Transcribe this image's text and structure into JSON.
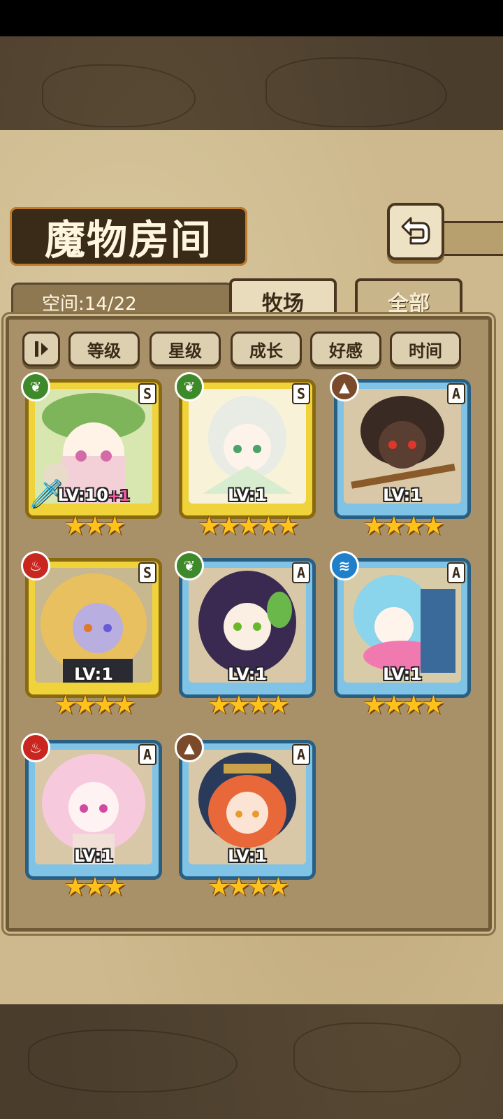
{
  "header": {
    "title": "魔物房间",
    "back_icon": "back-arrow-icon"
  },
  "storage": {
    "space_label": "空间:14/22"
  },
  "tabs": [
    {
      "label": "牧场",
      "active": true
    },
    {
      "label": "全部",
      "active": false
    }
  ],
  "filters": {
    "toggle_icon": "sort-toggle-icon",
    "items": [
      "等级",
      "星级",
      "成长",
      "好感",
      "时间"
    ]
  },
  "monsters": [
    {
      "element": "leaf",
      "rank": "S",
      "level": "LV:10",
      "bonus": "+1",
      "stars": "★★★",
      "frame": "gold",
      "equipped": "sword-icon"
    },
    {
      "element": "leaf",
      "rank": "S",
      "level": "LV:1",
      "bonus": "",
      "stars": "★★★★★",
      "frame": "gold",
      "equipped": ""
    },
    {
      "element": "earth",
      "rank": "A",
      "level": "LV:1",
      "bonus": "",
      "stars": "★★★★",
      "frame": "blue",
      "equipped": ""
    },
    {
      "element": "fire",
      "rank": "S",
      "level": "LV:1",
      "bonus": "",
      "stars": "★★★★",
      "frame": "gold",
      "equipped": ""
    },
    {
      "element": "leaf",
      "rank": "A",
      "level": "LV:1",
      "bonus": "",
      "stars": "★★★★",
      "frame": "blue",
      "equipped": ""
    },
    {
      "element": "water",
      "rank": "A",
      "level": "LV:1",
      "bonus": "",
      "stars": "★★★★",
      "frame": "blue",
      "equipped": ""
    },
    {
      "element": "fire",
      "rank": "A",
      "level": "LV:1",
      "bonus": "",
      "stars": "★★★",
      "frame": "blue",
      "equipped": ""
    },
    {
      "element": "earth",
      "rank": "A",
      "level": "LV:1",
      "bonus": "",
      "stars": "★★★★",
      "frame": "blue",
      "equipped": ""
    }
  ],
  "colors": {
    "gold_frame": "#f0d23a",
    "blue_frame": "#7fc3e6",
    "leaf": "#3e8a2a",
    "fire": "#c8261e",
    "earth": "#7a4a2a",
    "water": "#1f7fc9",
    "star": "#ffc21a"
  }
}
